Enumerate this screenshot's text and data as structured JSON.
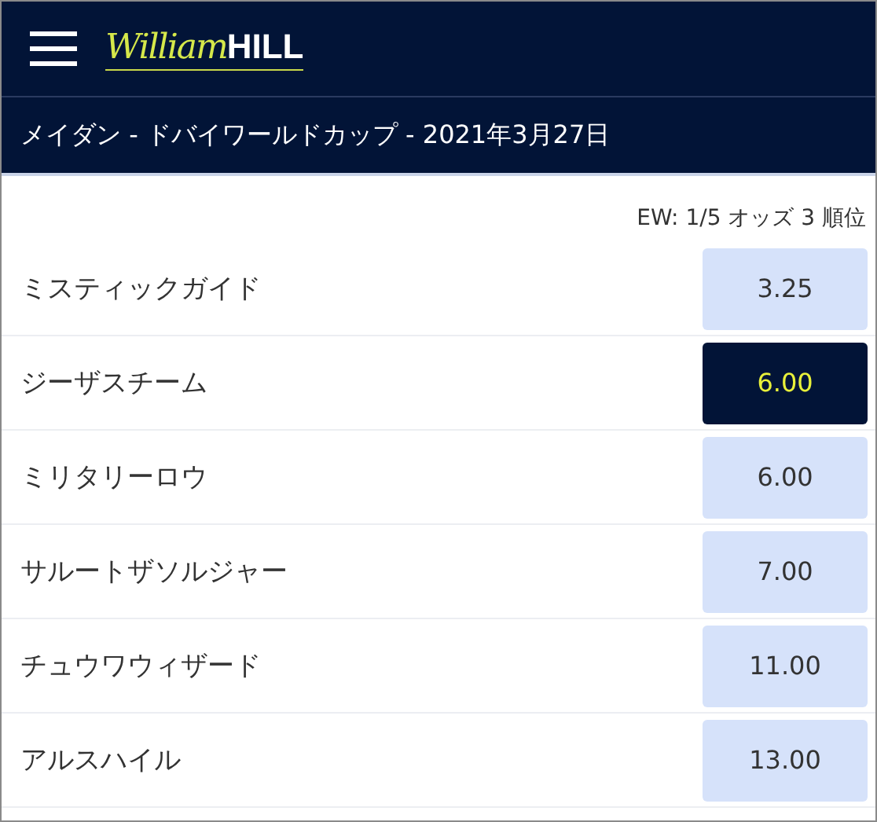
{
  "header": {
    "logo": {
      "script": "William",
      "bold": "HILL"
    }
  },
  "event_title": "メイダン - ドバイワールドカップ - 2021年3月27日",
  "each_way_terms": "EW: 1/5 オッズ 3 順位",
  "runners": [
    {
      "name": "ミスティックガイド",
      "odds": "3.25",
      "selected": false
    },
    {
      "name": "ジーザスチーム",
      "odds": "6.00",
      "selected": true
    },
    {
      "name": "ミリタリーロウ",
      "odds": "6.00",
      "selected": false
    },
    {
      "name": "サルートザソルジャー",
      "odds": "7.00",
      "selected": false
    },
    {
      "name": "チュウワウィザード",
      "odds": "11.00",
      "selected": false
    },
    {
      "name": "アルスハイル",
      "odds": "13.00",
      "selected": false
    }
  ]
}
